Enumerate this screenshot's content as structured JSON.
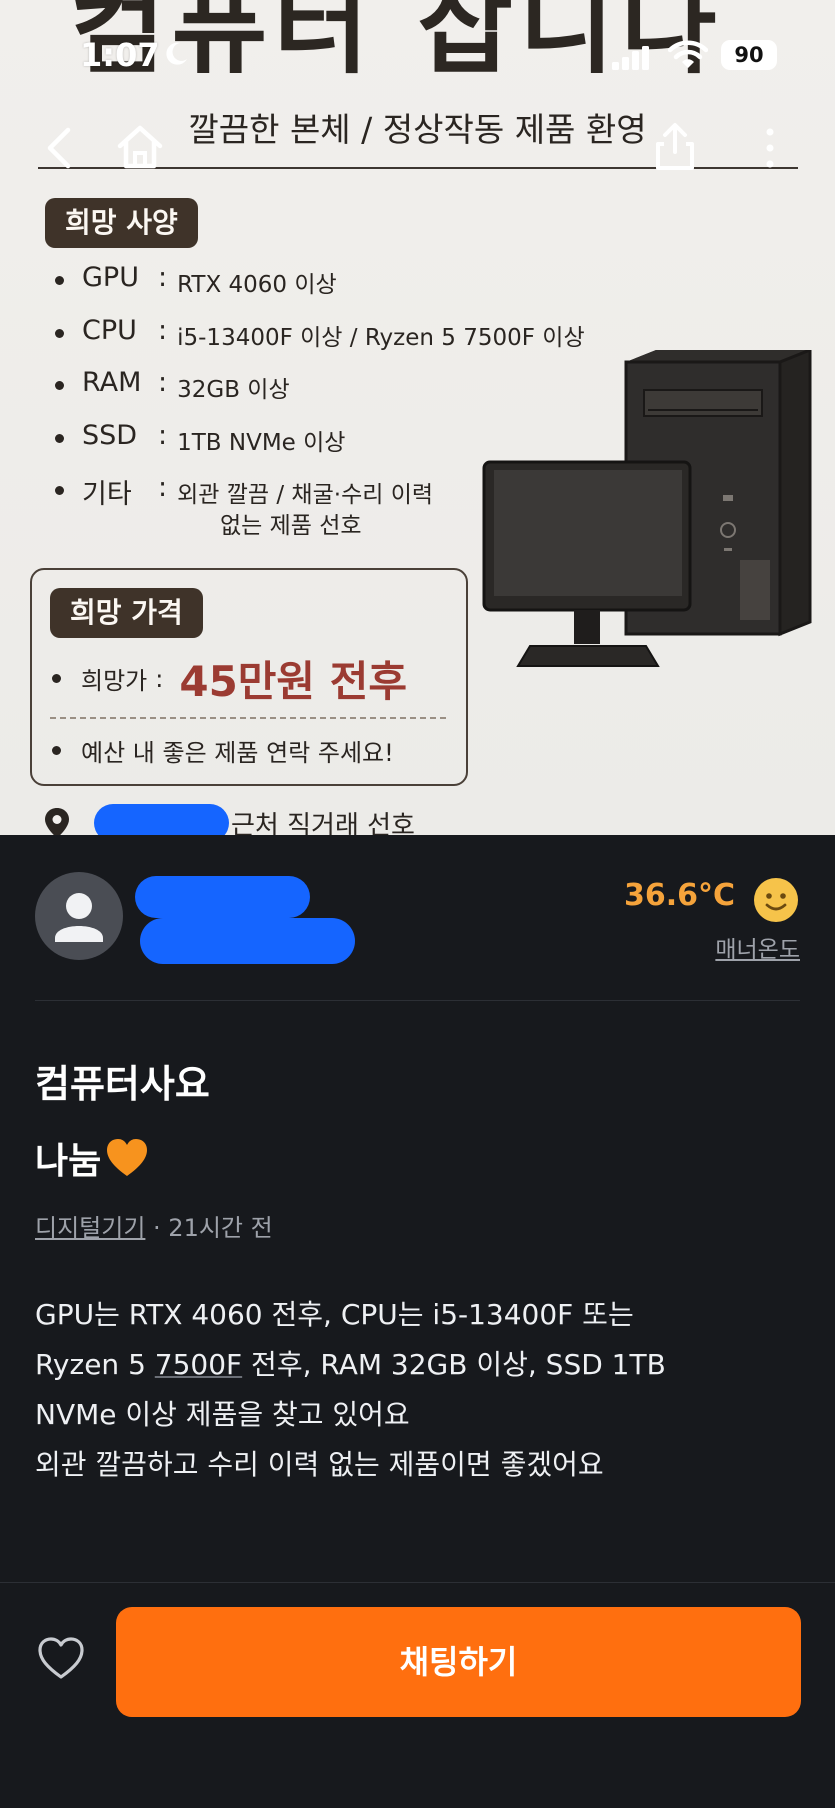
{
  "status_bar": {
    "time": "1:07",
    "battery": "90"
  },
  "hero": {
    "big_title": "컴퓨터 삽니다",
    "subtitle": "깔끔한 본체 / 정상작동 제품 환영",
    "spec_heading": "희망 사양",
    "specs": [
      {
        "key": "GPU",
        "value": "RTX 4060 이상"
      },
      {
        "key": "CPU",
        "value": "i5-13400F 이상 / Ryzen 5 7500F 이상"
      },
      {
        "key": "RAM",
        "value": "32GB 이상"
      },
      {
        "key": "SSD",
        "value": "1TB NVMe 이상"
      },
      {
        "key": "기타",
        "value": "외관 깔끔 / 채굴·수리 이력",
        "value_line2": "없는 제품 선호"
      }
    ],
    "colon": ":",
    "price_heading": "희망 가격",
    "price_label": "희망가",
    "price_value": "45만원 전후",
    "price_note": "예산 내 좋은 제품 연락 주세요!",
    "location_suffix": "근처 직거래 선호"
  },
  "seller": {
    "temperature": "36.6°C",
    "manner_label": "매너온도"
  },
  "post": {
    "title": "컴퓨터사요",
    "subtitle": "나눔",
    "category": "디지털기기",
    "separator": " · ",
    "time_ago": "21시간 전",
    "body": {
      "l1": "GPU는 RTX 4060 전후, CPU는 i5-13400F 또는",
      "l2a": "Ryzen 5 ",
      "l2b": "7500F",
      "l2c": " 전후, RAM 32GB 이상, SSD 1TB",
      "l3": "NVMe 이상 제품을 찾고 있어요",
      "l4": "외관 깔끔하고 수리 이력 없는 제품이면 좋겠어요"
    }
  },
  "bottom": {
    "chat_label": "채팅하기"
  },
  "colors": {
    "accent": "#ff6f0f",
    "temperature": "#f5a33b",
    "price": "#9b3b32",
    "redaction": "#1565ff"
  }
}
